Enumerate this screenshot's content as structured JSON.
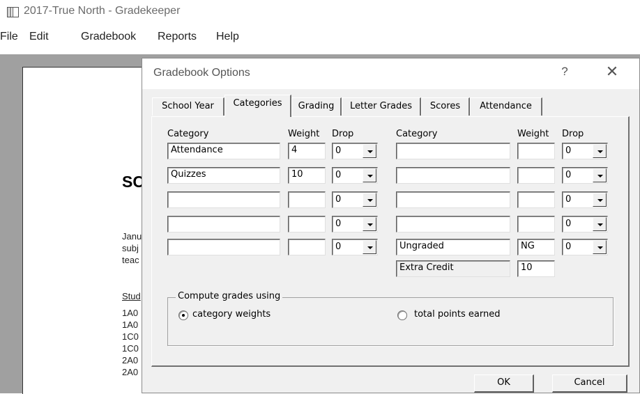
{
  "app": {
    "title": "2017-True North - Gradekeeper",
    "icon": "window-icon"
  },
  "menu": [
    "File",
    "Edit",
    "Gradebook",
    "Reports",
    "Help"
  ],
  "document": {
    "heading": "SC",
    "lines": [
      "Janu",
      "subj",
      "teac"
    ],
    "students_label": "Stud",
    "student_rows": [
      "1A0",
      "1A0",
      "1C0",
      "1C0",
      "2A0",
      "2A0"
    ]
  },
  "dialog": {
    "title": "Gradebook Options",
    "help_label": "?",
    "close_label": "✕",
    "tabs": [
      "School Year",
      "Categories",
      "Grading",
      "Letter Grades",
      "Scores",
      "Attendance"
    ],
    "active_tab": "Categories",
    "columns": {
      "category": "Category",
      "weight": "Weight",
      "drop": "Drop"
    },
    "left_rows": [
      {
        "category": "Attendance",
        "weight": "4",
        "drop": "0"
      },
      {
        "category": "Quizzes",
        "weight": "10",
        "drop": "0"
      },
      {
        "category": "",
        "weight": "",
        "drop": "0"
      },
      {
        "category": "",
        "weight": "",
        "drop": "0"
      },
      {
        "category": "",
        "weight": "",
        "drop": "0"
      }
    ],
    "right_rows": [
      {
        "category": "",
        "weight": "",
        "drop": "0"
      },
      {
        "category": "",
        "weight": "",
        "drop": "0"
      },
      {
        "category": "",
        "weight": "",
        "drop": "0"
      },
      {
        "category": "",
        "weight": "",
        "drop": "0"
      },
      {
        "category": "Ungraded",
        "weight": "NG",
        "drop": "0"
      }
    ],
    "extra_credit": {
      "label": "Extra Credit",
      "weight": "10"
    },
    "compute": {
      "legend": "Compute grades using",
      "option_weights": "category weights",
      "option_points": "total points earned",
      "selected": "category weights"
    },
    "ok_label": "OK",
    "cancel_label": "Cancel"
  }
}
